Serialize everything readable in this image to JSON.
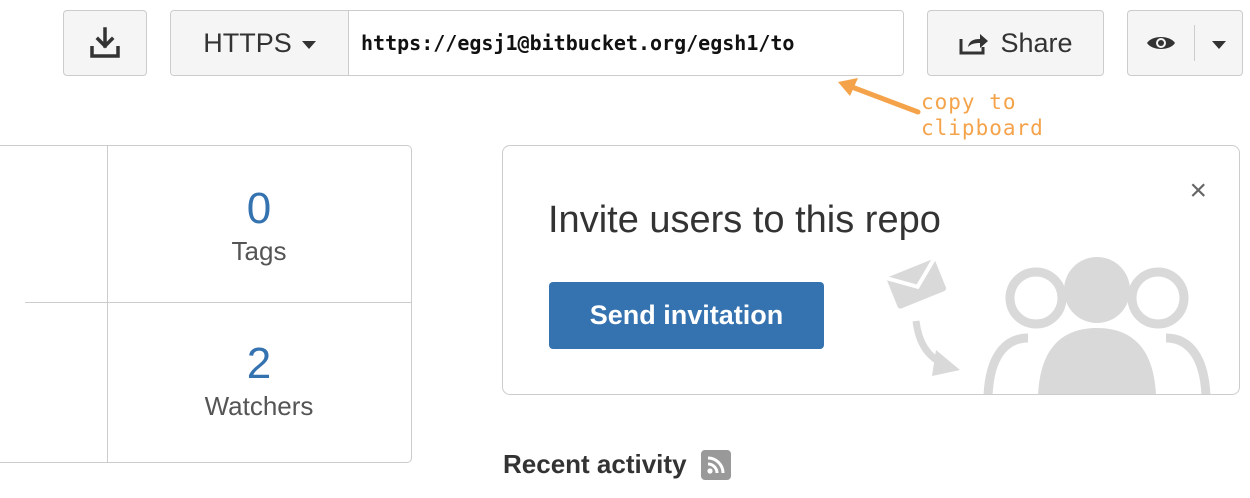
{
  "toolbar": {
    "download_icon": "download-icon",
    "protocol": "HTTPS",
    "clone_url": "https://egsj1@bitbucket.org/egsh1/to",
    "share_label": "Share",
    "share_icon": "share-icon",
    "watch_icon": "eye-icon"
  },
  "annotation": {
    "text_line1": "copy to",
    "text_line2": "clipboard",
    "color": "#f5a34a"
  },
  "stats": [
    {
      "value": "0",
      "label": "Tags"
    },
    {
      "value": "2",
      "label": "Watchers"
    }
  ],
  "invite": {
    "title": "Invite users to this repo",
    "button_label": "Send invitation",
    "close": "×",
    "button_color": "#3572b0"
  },
  "recent": {
    "title": "Recent activity",
    "icon": "rss-icon"
  }
}
